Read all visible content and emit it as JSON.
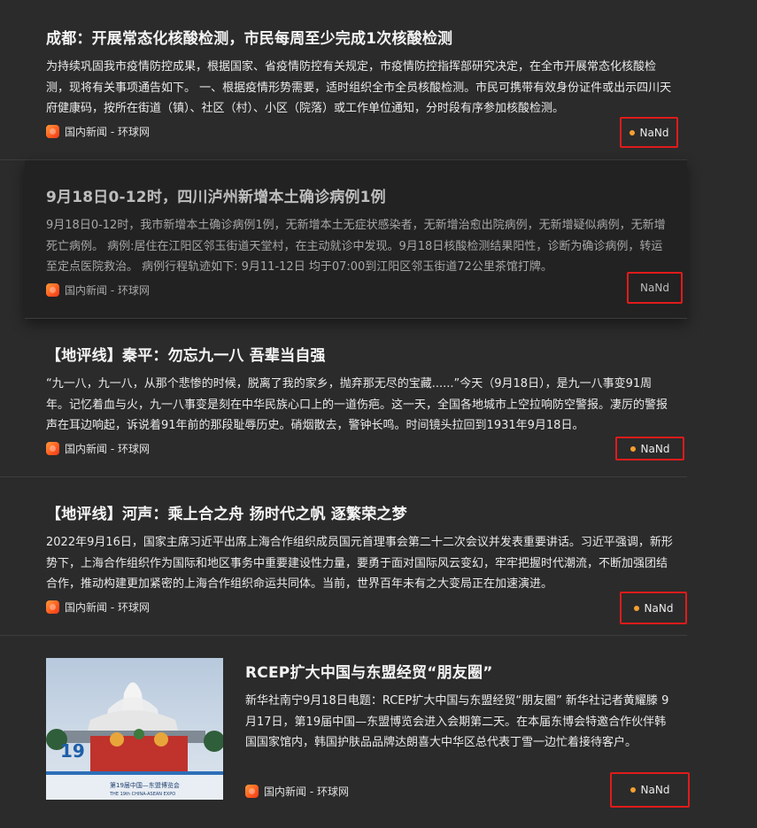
{
  "articles": [
    {
      "title": "成都：开展常态化核酸检测，市民每周至少完成1次核酸检测",
      "summary": "为持续巩固我市疫情防控成果，根据国家、省疫情防控有关规定，市疫情防控指挥部研究决定，在全市开展常态化核酸检测，现将有关事项通告如下。 一、根据疫情形势需要，适时组织全市全员核酸检测。市民可携带有效身份证件或出示四川天府健康码，按所在街道（镇）、社区（村）、小区（院落）或工作单位通知，分时段有序参加核酸检测。",
      "source": "国内新闻 - 环球网",
      "badge": "NaNd"
    },
    {
      "title": "9月18日0-12时，四川泸州新增本土确诊病例1例",
      "summary": "9月18日0-12时，我市新增本土确诊病例1例，无新增本土无症状感染者，无新增治愈出院病例，无新增疑似病例，无新增死亡病例。 病例:居住在江阳区邻玉街道天堂村，在主动就诊中发现。9月18日核酸检测结果阳性，诊断为确诊病例，转运至定点医院救治。 病例行程轨迹如下: 9月11-12日 均于07:00到江阳区邻玉街道72公里茶馆打牌。",
      "source": "国内新闻 - 环球网",
      "badge": "NaNd"
    },
    {
      "title": "【地评线】秦平：勿忘九一八 吾辈当自强",
      "summary": "“九一八，九一八，从那个悲惨的时候，脱离了我的家乡，抛弃那无尽的宝藏......”今天（9月18日），是九一八事变91周年。记忆着血与火，九一八事变是刻在中华民族心口上的一道伤疤。这一天，全国各地城市上空拉响防空警报。凄厉的警报声在耳边响起，诉说着91年前的那段耻辱历史。硝烟散去，警钟长鸣。时间镜头拉回到1931年9月18日。",
      "source": "国内新闻 - 环球网",
      "badge": "NaNd"
    },
    {
      "title": "【地评线】河声：乘上合之舟 扬时代之帆 逐繁荣之梦",
      "summary": "2022年9月16日，国家主席习近平出席上海合作组织成员国元首理事会第二十二次会议并发表重要讲话。习近平强调，新形势下，上海合作组织作为国际和地区事务中重要建设性力量，要勇于面对国际风云变幻，牢牢把握时代潮流，不断加强团结合作，推动构建更加紧密的上海合作组织命运共同体。当前，世界百年未有之大变局正在加速演进。",
      "source": "国内新闻 - 环球网",
      "badge": "NaNd"
    },
    {
      "title": "RCEP扩大中国与东盟经贸“朋友圈”",
      "summary": "新华社南宁9月18日电题：RCEP扩大中国与东盟经贸“朋友圈” 新华社记者黄耀滕 9月17日，第19届中国—东盟博览会进入会期第二天。在本届东博会特邀合作伙伴韩国国家馆内，韩国护肤品品牌达朗喜大中华区总代表丁雪一边忙着接待客户。",
      "source": "国内新闻 - 环球网",
      "badge": "NaNd",
      "image_banner_text": "第19届中国—东盟博览会",
      "image_banner_subtext": "THE 19th CHINA-ASEAN EXPO",
      "image_logo_text": "19"
    }
  ],
  "colors": {
    "background": "#2b2b2b",
    "badge_border": "#e01b1b",
    "badge_dot": "#f5a030",
    "source_logo": "#ff6a2a"
  },
  "icons": {
    "source_logo": "huanqiu-logo-icon",
    "badge_dot": "dot-icon"
  }
}
